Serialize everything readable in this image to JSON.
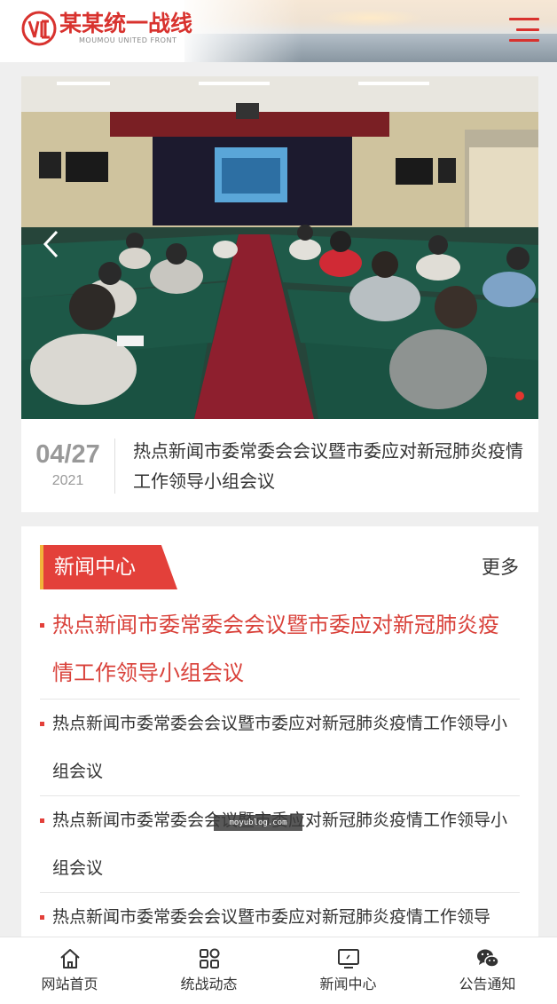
{
  "header": {
    "logo_title": "某某统一战线",
    "logo_subtitle": "MOUMOU UNITED FRONT",
    "logo_icon": "united-front-logo",
    "menu_icon": "hamburger-menu-icon",
    "accent_color": "#d8322e"
  },
  "banner": {
    "date_md": "04/27",
    "date_year": "2021",
    "caption": "热点新闻市委常委会会议暨市委应对新冠肺炎疫情工作领导小组会议",
    "prev_icon": "chevron-left-icon",
    "active_dot_color": "#e2362f"
  },
  "news": {
    "section_title": "新闻中心",
    "more_label": "更多",
    "items": [
      {
        "title": "热点新闻市委常委会会议暨市委应对新冠肺炎疫情工作领导小组会议"
      },
      {
        "title": "热点新闻市委常委会会议暨市委应对新冠肺炎疫情工作领导小组会议"
      },
      {
        "title": "热点新闻市委常委会会议暨市委应对新冠肺炎疫情工作领导小组会议"
      },
      {
        "title": "热点新闻市委常委会会议暨市委应对新冠肺炎疫情工作领导"
      }
    ]
  },
  "watermark": "moyublog.com",
  "bottom_nav": {
    "items": [
      {
        "label": "网站首页",
        "icon": "home-icon"
      },
      {
        "label": "统战动态",
        "icon": "grid-icon"
      },
      {
        "label": "新闻中心",
        "icon": "monitor-icon"
      },
      {
        "label": "公告通知",
        "icon": "wechat-icon"
      }
    ]
  }
}
